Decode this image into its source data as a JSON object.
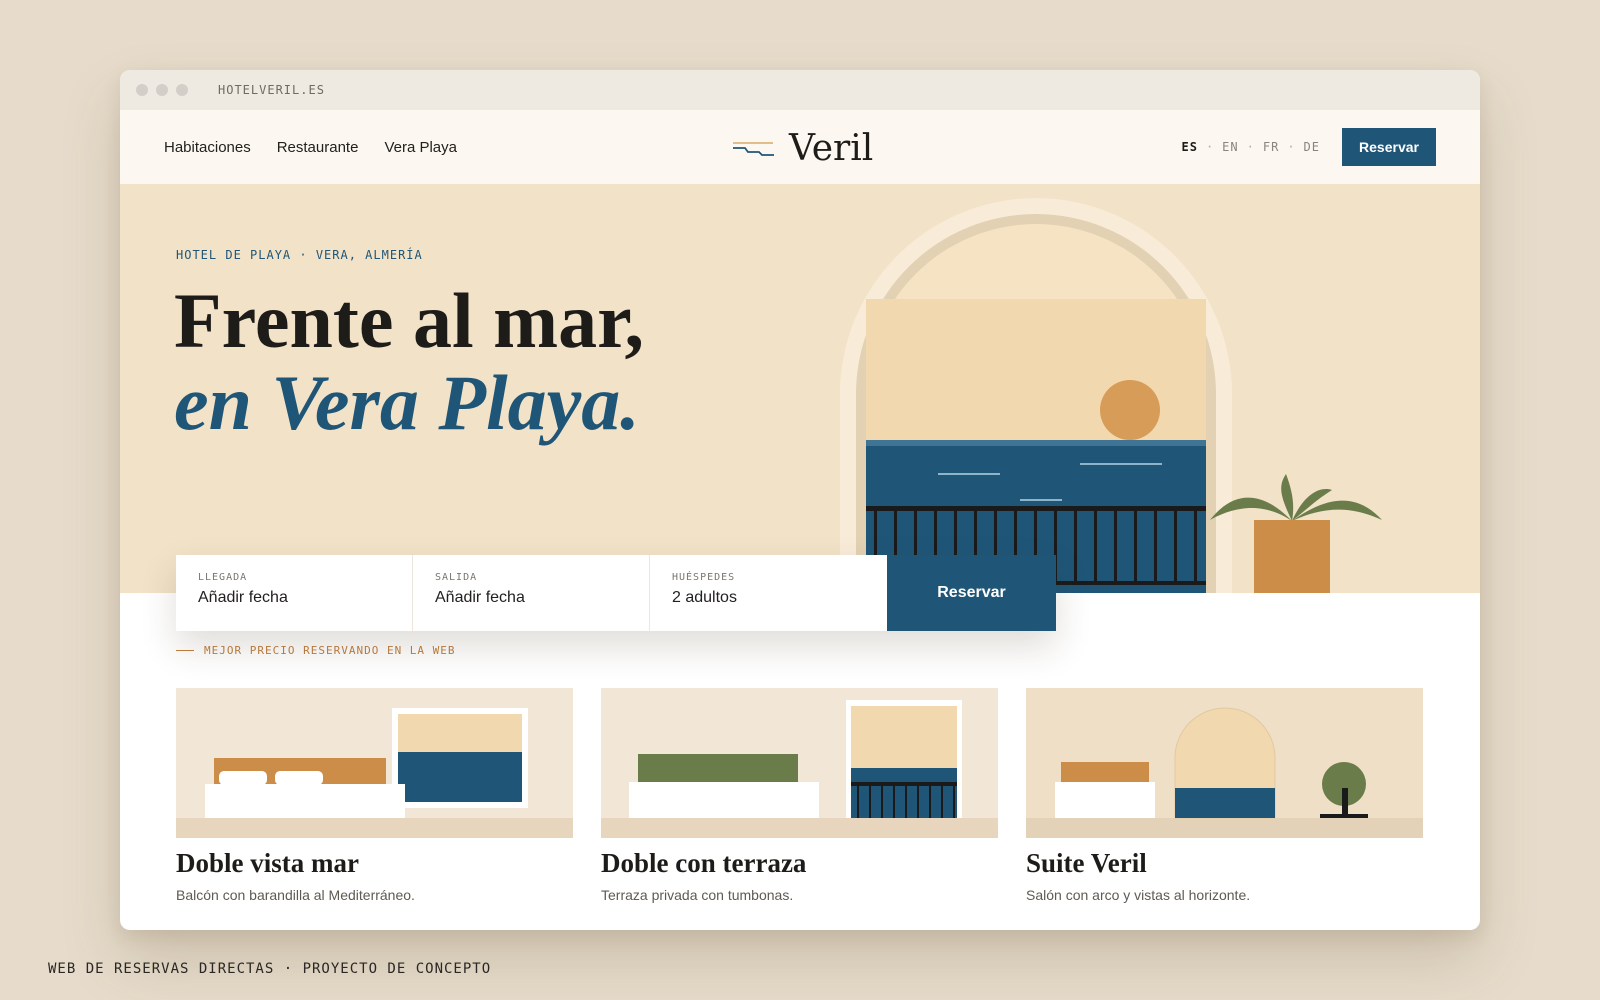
{
  "browser": {
    "url": "HOTELVERIL.ES"
  },
  "nav": {
    "links": [
      "Habitaciones",
      "Restaurante",
      "Vera Playa"
    ],
    "brand": "Veril",
    "languages": [
      "ES",
      "EN",
      "FR",
      "DE"
    ],
    "active_language": "ES",
    "lang_separator": "·",
    "reserve_label": "Reservar"
  },
  "hero": {
    "eyebrow": "HOTEL DE PLAYA · VERA, ALMERÍA",
    "headline_line1": "Frente al mar,",
    "headline_line2": "en Vera Playa."
  },
  "booking": {
    "fields": [
      {
        "label": "LLEGADA",
        "value": "Añadir fecha"
      },
      {
        "label": "SALIDA",
        "value": "Añadir fecha"
      },
      {
        "label": "HUÉSPEDES",
        "value": "2 adultos"
      }
    ],
    "submit_label": "Reservar"
  },
  "promo": {
    "best_price": "MEJOR PRECIO RESERVANDO EN LA WEB"
  },
  "rooms": [
    {
      "name": "Doble vista mar",
      "description": "Balcón con barandilla al Mediterráneo."
    },
    {
      "name": "Doble con terraza",
      "description": "Terraza privada con tumbonas."
    },
    {
      "name": "Suite Veril",
      "description": "Salón con arco y vistas al horizonte."
    }
  ],
  "footer": {
    "caption": "WEB DE RESERVAS DIRECTAS · PROYECTO DE CONCEPTO"
  },
  "icons": {
    "brand_logo": "horizon-lines-icon",
    "window_controls": "traffic-light-dots"
  },
  "colors": {
    "accent": "#1f5678",
    "sand": "#f1e2c8",
    "terracotta": "#cc8d48",
    "olive": "#6b7c4b",
    "page_bg": "#e7dccb"
  }
}
